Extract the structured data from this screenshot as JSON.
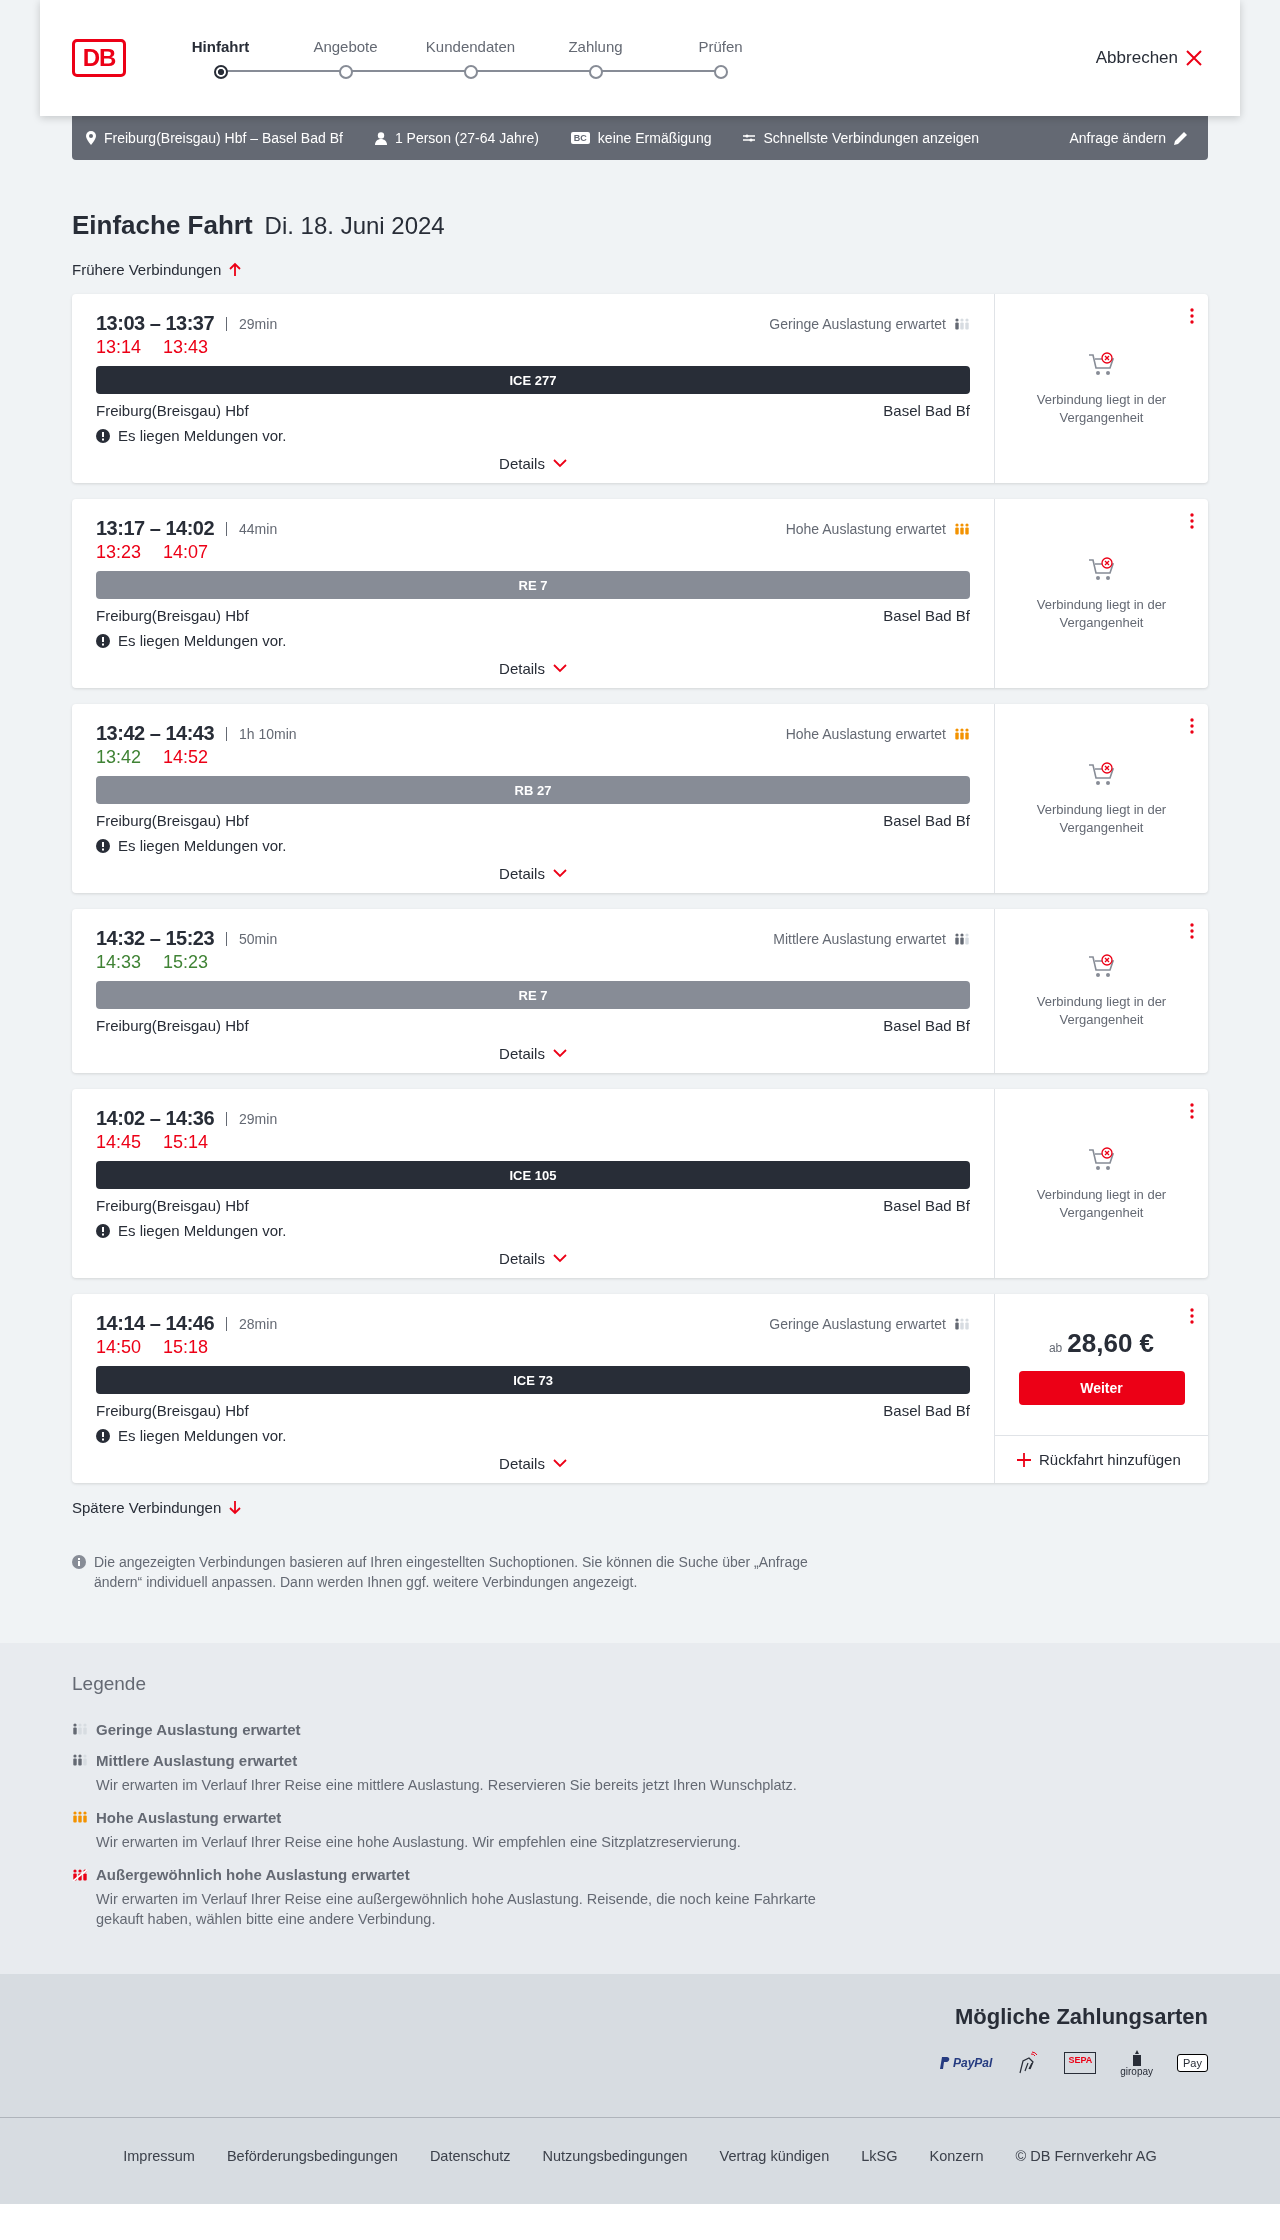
{
  "header": {
    "logo": "DB",
    "steps": [
      {
        "label": "Hinfahrt",
        "selected": true
      },
      {
        "label": "Angebote",
        "selected": false
      },
      {
        "label": "Kundendaten",
        "selected": false
      },
      {
        "label": "Zahlung",
        "selected": false
      },
      {
        "label": "Prüfen",
        "selected": false
      }
    ],
    "cancel": "Abbrechen"
  },
  "summary": {
    "route": "Freiburg(Breisgau) Hbf – Basel Bad Bf",
    "passengers": "1 Person (27-64 Jahre)",
    "discount_badge": "BC",
    "discount": "keine Ermäßigung",
    "option": "Schnellste Verbindungen anzeigen",
    "edit": "Anfrage ändern"
  },
  "heading": {
    "title": "Einfache Fahrt",
    "date": "Di. 18. Juni 2024"
  },
  "earlier": "Frühere Verbindungen",
  "connections": [
    {
      "times": "13:03 – 13:37",
      "duration": "29min",
      "occupancy": {
        "kind": "low",
        "label": "Geringe Auslastung erwartet"
      },
      "realtime": [
        {
          "time": "13:14",
          "on_time": false
        },
        {
          "time": "13:43",
          "on_time": false
        }
      ],
      "train": {
        "label": "ICE 277",
        "kind": "long_distance"
      },
      "from": "Freiburg(Breisgau) Hbf",
      "to": "Basel Bad Bf",
      "message": "Es liegen Meldungen vor.",
      "details": "Details",
      "offer": {
        "kind": "past",
        "text": "Verbindung liegt in der Vergangenheit"
      }
    },
    {
      "times": "13:17 – 14:02",
      "duration": "44min",
      "occupancy": {
        "kind": "high",
        "label": "Hohe Auslastung erwartet"
      },
      "realtime": [
        {
          "time": "13:23",
          "on_time": false
        },
        {
          "time": "14:07",
          "on_time": false
        }
      ],
      "train": {
        "label": "RE 7",
        "kind": "regional"
      },
      "from": "Freiburg(Breisgau) Hbf",
      "to": "Basel Bad Bf",
      "message": "Es liegen Meldungen vor.",
      "details": "Details",
      "offer": {
        "kind": "past",
        "text": "Verbindung liegt in der Vergangenheit"
      }
    },
    {
      "times": "13:42 – 14:43",
      "duration": "1h 10min",
      "occupancy": {
        "kind": "high",
        "label": "Hohe Auslastung erwartet"
      },
      "realtime": [
        {
          "time": "13:42",
          "on_time": true
        },
        {
          "time": "14:52",
          "on_time": false
        }
      ],
      "train": {
        "label": "RB 27",
        "kind": "regional"
      },
      "from": "Freiburg(Breisgau) Hbf",
      "to": "Basel Bad Bf",
      "message": "Es liegen Meldungen vor.",
      "details": "Details",
      "offer": {
        "kind": "past",
        "text": "Verbindung liegt in der Vergangenheit"
      }
    },
    {
      "times": "14:32 – 15:23",
      "duration": "50min",
      "occupancy": {
        "kind": "medium",
        "label": "Mittlere Auslastung erwartet"
      },
      "realtime": [
        {
          "time": "14:33",
          "on_time": true
        },
        {
          "time": "15:23",
          "on_time": true
        }
      ],
      "train": {
        "label": "RE 7",
        "kind": "regional"
      },
      "from": "Freiburg(Breisgau) Hbf",
      "to": "Basel Bad Bf",
      "details": "Details",
      "offer": {
        "kind": "past",
        "text": "Verbindung liegt in der Vergangenheit"
      }
    },
    {
      "times": "14:02 – 14:36",
      "duration": "29min",
      "realtime": [
        {
          "time": "14:45",
          "on_time": false
        },
        {
          "time": "15:14",
          "on_time": false
        }
      ],
      "train": {
        "label": "ICE 105",
        "kind": "long_distance"
      },
      "from": "Freiburg(Breisgau) Hbf",
      "to": "Basel Bad Bf",
      "message": "Es liegen Meldungen vor.",
      "details": "Details",
      "offer": {
        "kind": "past",
        "text": "Verbindung liegt in der Vergangenheit"
      }
    },
    {
      "times": "14:14 – 14:46",
      "duration": "28min",
      "occupancy": {
        "kind": "low",
        "label": "Geringe Auslastung erwartet"
      },
      "realtime": [
        {
          "time": "14:50",
          "on_time": false
        },
        {
          "time": "15:18",
          "on_time": false
        }
      ],
      "train": {
        "label": "ICE 73",
        "kind": "long_distance"
      },
      "from": "Freiburg(Breisgau) Hbf",
      "to": "Basel Bad Bf",
      "message": "Es liegen Meldungen vor.",
      "details": "Details",
      "offer": {
        "kind": "offer",
        "prefix": "ab",
        "price": "28,60 €",
        "button": "Weiter",
        "return": "Rückfahrt hinzufügen"
      }
    }
  ],
  "later": "Spätere Verbindungen",
  "note": "Die angezeigten Verbindungen basieren auf Ihren eingestellten Suchoptionen. Sie können die Suche über „Anfrage ändern“ individuell anpassen. Dann werden Ihnen ggf. weitere Verbindungen angezeigt.",
  "legend": {
    "title": "Legende",
    "items": [
      {
        "kind": "low",
        "title": "Geringe Auslastung erwartet"
      },
      {
        "kind": "medium",
        "title": "Mittlere Auslastung erwartet",
        "text": "Wir erwarten im Verlauf Ihrer Reise eine mittlere Auslastung. Reservieren Sie bereits jetzt Ihren Wunschplatz."
      },
      {
        "kind": "high",
        "title": "Hohe Auslastung erwartet",
        "text": "Wir erwarten im Verlauf Ihrer Reise eine hohe Auslastung. Wir empfehlen eine Sitzplatzreservierung."
      },
      {
        "kind": "extreme",
        "title": "Außergewöhnlich hohe Auslastung erwartet",
        "text": "Wir erwarten im Verlauf Ihrer Reise eine außergewöhnlich hohe Auslastung. Reisende, die noch keine Fahrkarte gekauft haben, wählen bitte eine andere Verbindung."
      }
    ]
  },
  "payment": {
    "title": "Mögliche Zahlungsarten",
    "methods": [
      {
        "kind": "paypal",
        "label": "PayPal"
      },
      {
        "kind": "card"
      },
      {
        "kind": "sepa",
        "label": "SEPA"
      },
      {
        "kind": "giropay",
        "label": "giropay"
      },
      {
        "kind": "applepay",
        "label": "Pay"
      }
    ]
  },
  "footer": [
    "Impressum",
    "Beförderungsbedingungen",
    "Datenschutz",
    "Nutzungsbedingungen",
    "Vertrag kündigen",
    "LkSG",
    "Konzern",
    "© DB Fernverkehr AG"
  ]
}
